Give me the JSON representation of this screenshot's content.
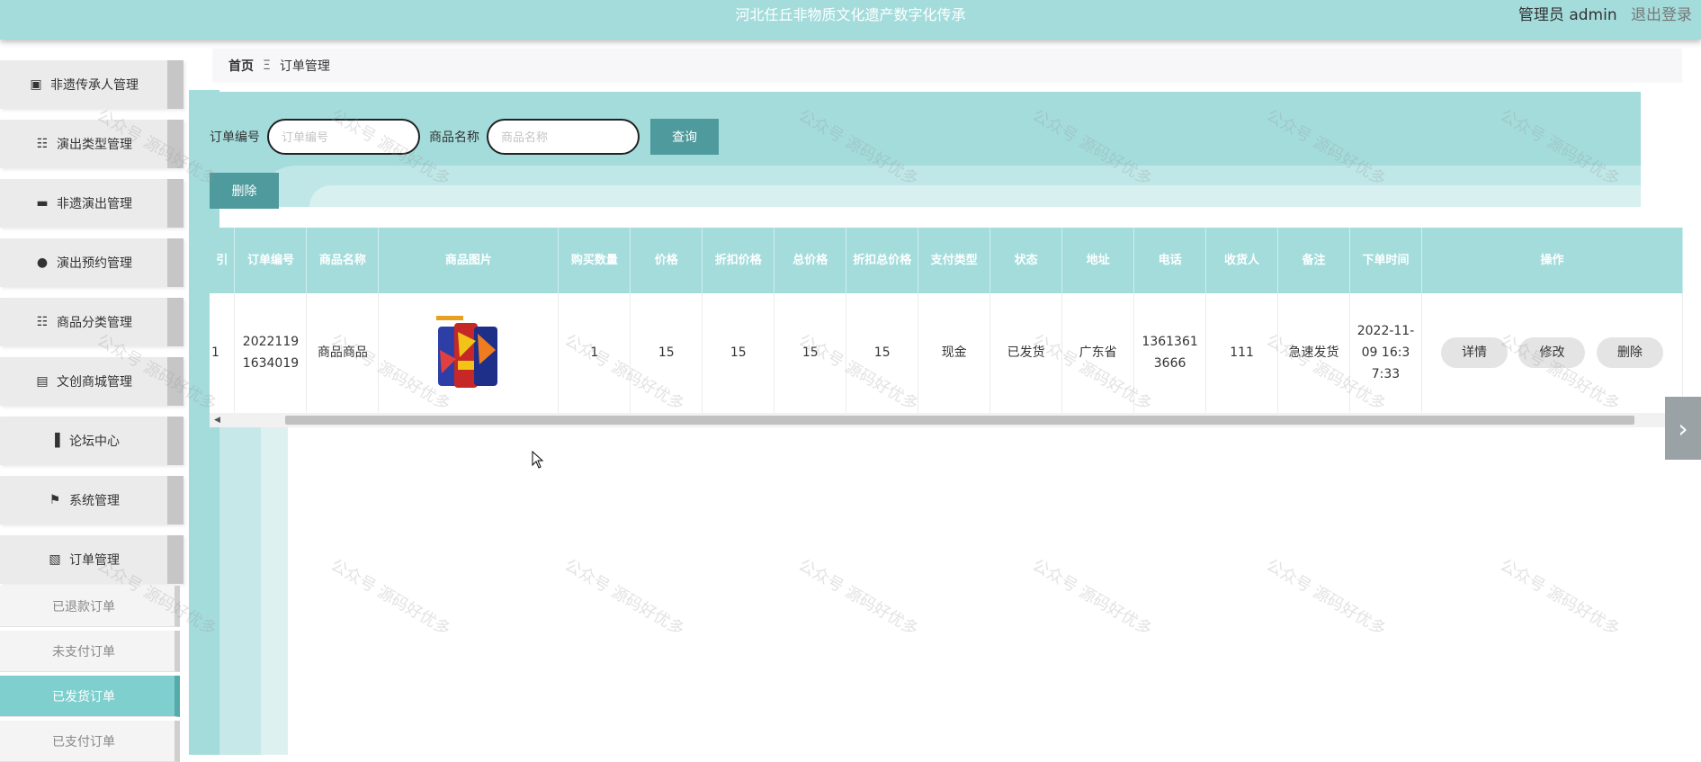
{
  "header": {
    "site_title": "河北任丘非物质文化遗产数字化传承",
    "user_label": "管理员 admin",
    "logout_label": "退出登录"
  },
  "sidebar": {
    "items": [
      {
        "label": "非遗传承人管理",
        "icon": "id-card-icon"
      },
      {
        "label": "演出类型管理",
        "icon": "grid-icon"
      },
      {
        "label": "非遗演出管理",
        "icon": "monitor-icon"
      },
      {
        "label": "演出预约管理",
        "icon": "lightbulb-icon"
      },
      {
        "label": "商品分类管理",
        "icon": "grid-icon"
      },
      {
        "label": "文创商城管理",
        "icon": "store-icon"
      },
      {
        "label": "论坛中心",
        "icon": "bar-chart-icon"
      },
      {
        "label": "系统管理",
        "icon": "flag-icon"
      },
      {
        "label": "订单管理",
        "icon": "clipboard-icon"
      }
    ],
    "subitems": [
      {
        "label": "已退款订单",
        "active": false
      },
      {
        "label": "未支付订单",
        "active": false
      },
      {
        "label": "已发货订单",
        "active": true
      },
      {
        "label": "已支付订单",
        "active": false
      }
    ]
  },
  "breadcrumb": {
    "home": "首页",
    "separator": "Ξ",
    "current": "订单管理"
  },
  "search": {
    "order_no_label": "订单编号",
    "order_no_placeholder": "订单编号",
    "product_name_label": "商品名称",
    "product_name_placeholder": "商品名称",
    "query_button": "查询"
  },
  "toolbar": {
    "delete_button": "删除"
  },
  "table": {
    "headers": [
      "引",
      "订单编号",
      "商品名称",
      "商品图片",
      "购买数量",
      "价格",
      "折扣价格",
      "总价格",
      "折扣总价格",
      "支付类型",
      "状态",
      "地址",
      "电话",
      "收货人",
      "备注",
      "下单时间",
      "操作"
    ],
    "rows": [
      {
        "index": "1",
        "order_no": "20221191634019",
        "product_name": "商品商品",
        "quantity": "1",
        "price": "15",
        "discount_price": "15",
        "total_price": "15",
        "discount_total": "15",
        "pay_type": "现金",
        "status": "已发货",
        "address": "广东省",
        "phone": "13613613666",
        "receiver": "111",
        "remark": "急速发货",
        "order_time": "2022-11-09 16:37:33",
        "actions": [
          "详情",
          "修改",
          "删除"
        ]
      }
    ]
  },
  "watermark": "公众号 源码好优多",
  "colors": {
    "accent": "#a4dcdc",
    "button": "#4f9a9c",
    "active_sub": "#7fcfcf"
  }
}
